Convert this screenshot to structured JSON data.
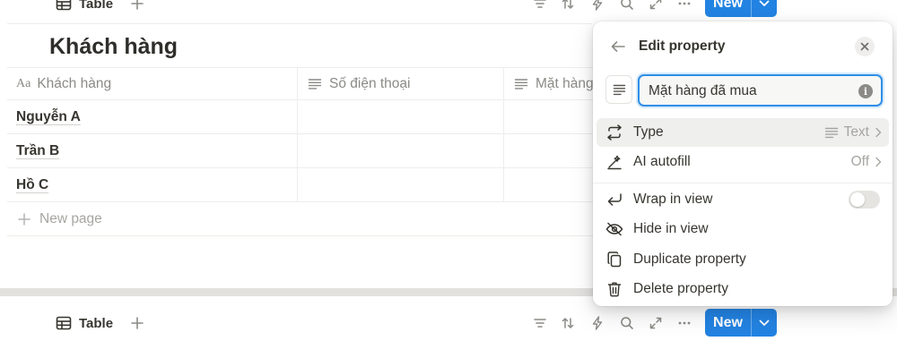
{
  "view_toolbar": {
    "tab_label": "Table",
    "new_label": "New"
  },
  "database": {
    "title": "Khách hàng",
    "columns": [
      {
        "prefix": "Aa",
        "label": "Khách hàng"
      },
      {
        "label": "Số điện thoại"
      },
      {
        "label": "Mặt hàng"
      }
    ],
    "rows": [
      {
        "name": "Nguyễn A"
      },
      {
        "name": "Trần B"
      },
      {
        "name": "Hồ C"
      }
    ],
    "new_page_label": "New page"
  },
  "edit_property": {
    "title": "Edit property",
    "name_value": "Mặt hàng đã mua",
    "type_label": "Type",
    "type_value": "Text",
    "ai_autofill_label": "AI autofill",
    "ai_autofill_value": "Off",
    "wrap_label": "Wrap in view",
    "wrap_enabled": false,
    "hide_label": "Hide in view",
    "duplicate_label": "Duplicate property",
    "delete_label": "Delete property"
  },
  "colors": {
    "accent": "#2383e2",
    "text": "#37352f",
    "muted": "#8b8a86"
  }
}
